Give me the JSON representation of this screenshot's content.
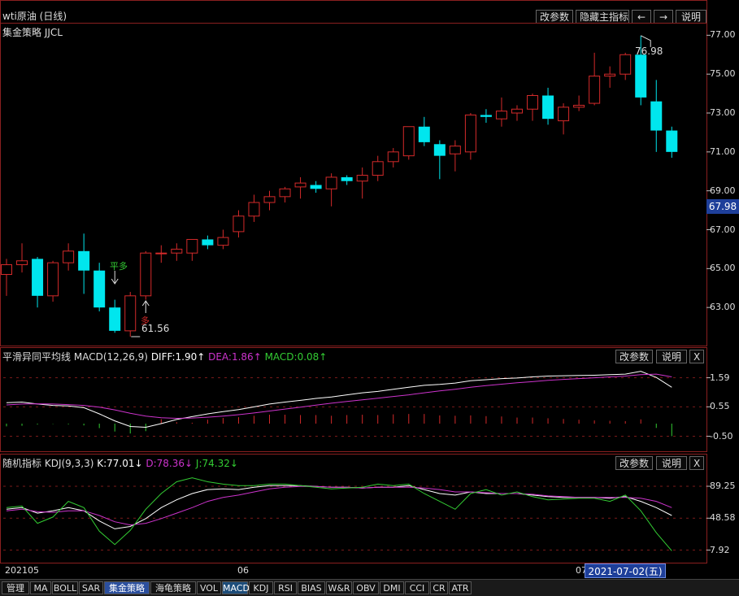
{
  "header": {
    "title": "wti原油 (日线)",
    "strategy": "集金策略 JJCL",
    "buttons": [
      "改参数",
      "隐藏主指标",
      "←",
      "→",
      "说明"
    ]
  },
  "price_axis": [
    "77.00",
    "75.00",
    "73.00",
    "71.00",
    "69.00",
    "67.00",
    "65.00",
    "63.00"
  ],
  "current_price": "67.98",
  "annotations": {
    "high_label": "76.98",
    "low_label": "61.56",
    "signal_close_long": "平多",
    "signal_long": "多"
  },
  "macd_panel": {
    "name": "平滑异同平均线",
    "params": "MACD(12,26,9)",
    "diff": "DIFF:1.90↑",
    "dea": "DEA:1.86↑",
    "macd": "MACD:0.08↑",
    "axis": [
      "1.59",
      "0.55",
      "-0.50"
    ],
    "buttons": [
      "改参数",
      "说明",
      "X"
    ]
  },
  "kdj_panel": {
    "name": "随机指标",
    "params": "KDJ(9,3,3)",
    "k": "K:77.01↓",
    "d": "D:78.36↓",
    "j": "J:74.32↓",
    "axis": [
      "89.25",
      "48.58",
      "7.92"
    ],
    "buttons": [
      "改参数",
      "说明",
      "X"
    ]
  },
  "x_axis": {
    "labels": [
      "202105",
      "06",
      "07"
    ],
    "selected_date": "2021-07-02(五)"
  },
  "tabs": [
    "管理",
    "MA",
    "BOLL",
    "SAR",
    "集金策略",
    "海龟策略",
    "VOL",
    "MACD",
    "KDJ",
    "RSI",
    "BIAS",
    "W&R",
    "OBV",
    "DMI",
    "CCI",
    "CR",
    "ATR"
  ],
  "colors": {
    "up": "#d42a2a",
    "down": "#00e6ee",
    "diff": "#ffffff",
    "dea": "#cc33cc",
    "j_line": "#33cc33",
    "grid": "#8a1f1f"
  },
  "chart_data": [
    {
      "type": "candlestick",
      "title": "wti原油 (日线)",
      "ylim": [
        61.0,
        77.6
      ],
      "candles": [
        {
          "o": 64.7,
          "h": 65.5,
          "l": 63.6,
          "c": 65.2
        },
        {
          "o": 65.2,
          "h": 66.3,
          "l": 64.8,
          "c": 65.4
        },
        {
          "o": 65.5,
          "h": 65.6,
          "l": 63.0,
          "c": 63.6
        },
        {
          "o": 63.6,
          "h": 65.4,
          "l": 63.3,
          "c": 65.3
        },
        {
          "o": 65.3,
          "h": 66.3,
          "l": 64.9,
          "c": 65.9
        },
        {
          "o": 65.9,
          "h": 66.8,
          "l": 63.7,
          "c": 64.9
        },
        {
          "o": 64.9,
          "h": 65.3,
          "l": 62.8,
          "c": 63.0
        },
        {
          "o": 63.0,
          "h": 63.4,
          "l": 61.7,
          "c": 61.8
        },
        {
          "o": 61.8,
          "h": 63.8,
          "l": 61.5,
          "c": 63.6
        },
        {
          "o": 63.6,
          "h": 65.9,
          "l": 63.4,
          "c": 65.8
        },
        {
          "o": 65.8,
          "h": 66.2,
          "l": 65.3,
          "c": 65.8
        },
        {
          "o": 65.8,
          "h": 66.3,
          "l": 65.4,
          "c": 66.0
        },
        {
          "o": 65.8,
          "h": 66.5,
          "l": 65.4,
          "c": 66.5
        },
        {
          "o": 66.5,
          "h": 66.7,
          "l": 66.0,
          "c": 66.2
        },
        {
          "o": 66.2,
          "h": 67.0,
          "l": 66.0,
          "c": 66.6
        },
        {
          "o": 66.9,
          "h": 68.0,
          "l": 66.6,
          "c": 67.7
        },
        {
          "o": 67.7,
          "h": 68.8,
          "l": 67.4,
          "c": 68.4
        },
        {
          "o": 68.4,
          "h": 69.0,
          "l": 68.0,
          "c": 68.7
        },
        {
          "o": 68.7,
          "h": 69.2,
          "l": 68.4,
          "c": 69.1
        },
        {
          "o": 69.2,
          "h": 69.7,
          "l": 68.6,
          "c": 69.4
        },
        {
          "o": 69.3,
          "h": 69.5,
          "l": 68.9,
          "c": 69.1
        },
        {
          "o": 69.1,
          "h": 69.9,
          "l": 68.2,
          "c": 69.7
        },
        {
          "o": 69.7,
          "h": 69.8,
          "l": 69.3,
          "c": 69.5
        },
        {
          "o": 69.5,
          "h": 70.2,
          "l": 68.6,
          "c": 69.8
        },
        {
          "o": 69.8,
          "h": 70.8,
          "l": 69.5,
          "c": 70.5
        },
        {
          "o": 70.5,
          "h": 71.2,
          "l": 70.2,
          "c": 71.0
        },
        {
          "o": 70.8,
          "h": 72.3,
          "l": 70.6,
          "c": 72.3
        },
        {
          "o": 72.3,
          "h": 72.8,
          "l": 71.3,
          "c": 71.5
        },
        {
          "o": 71.4,
          "h": 71.6,
          "l": 69.6,
          "c": 70.8
        },
        {
          "o": 70.9,
          "h": 71.6,
          "l": 70.0,
          "c": 71.3
        },
        {
          "o": 71.0,
          "h": 73.0,
          "l": 70.6,
          "c": 72.9
        },
        {
          "o": 72.9,
          "h": 73.2,
          "l": 72.5,
          "c": 72.8
        },
        {
          "o": 72.7,
          "h": 73.8,
          "l": 72.3,
          "c": 73.1
        },
        {
          "o": 73.0,
          "h": 73.4,
          "l": 72.6,
          "c": 73.2
        },
        {
          "o": 73.2,
          "h": 74.0,
          "l": 72.6,
          "c": 73.9
        },
        {
          "o": 73.9,
          "h": 74.3,
          "l": 72.4,
          "c": 72.7
        },
        {
          "o": 72.6,
          "h": 73.5,
          "l": 71.9,
          "c": 73.3
        },
        {
          "o": 73.3,
          "h": 73.9,
          "l": 73.1,
          "c": 73.4
        },
        {
          "o": 73.5,
          "h": 76.1,
          "l": 73.4,
          "c": 74.9
        },
        {
          "o": 74.9,
          "h": 75.4,
          "l": 74.3,
          "c": 75.0
        },
        {
          "o": 75.0,
          "h": 76.1,
          "l": 74.7,
          "c": 76.0
        },
        {
          "o": 76.0,
          "h": 76.98,
          "l": 73.4,
          "c": 73.8
        },
        {
          "o": 73.6,
          "h": 74.7,
          "l": 71.0,
          "c": 72.1
        },
        {
          "o": 72.1,
          "h": 72.3,
          "l": 70.7,
          "c": 71.0
        }
      ]
    },
    {
      "type": "line",
      "title": "平滑异同平均线 MACD(12,26,9)",
      "ylim": [
        -0.95,
        2.1
      ],
      "series": [
        {
          "name": "DIFF",
          "values": [
            0.7,
            0.72,
            0.65,
            0.6,
            0.58,
            0.52,
            0.3,
            0.05,
            -0.15,
            -0.18,
            -0.05,
            0.1,
            0.2,
            0.3,
            0.38,
            0.45,
            0.55,
            0.65,
            0.72,
            0.78,
            0.85,
            0.9,
            0.98,
            1.05,
            1.1,
            1.18,
            1.25,
            1.32,
            1.35,
            1.4,
            1.48,
            1.52,
            1.56,
            1.58,
            1.62,
            1.65,
            1.66,
            1.67,
            1.68,
            1.7,
            1.72,
            1.82,
            1.6,
            1.25
          ]
        },
        {
          "name": "DEA",
          "values": [
            0.62,
            0.65,
            0.66,
            0.65,
            0.63,
            0.6,
            0.54,
            0.44,
            0.32,
            0.22,
            0.16,
            0.14,
            0.15,
            0.18,
            0.22,
            0.27,
            0.33,
            0.4,
            0.47,
            0.54,
            0.61,
            0.68,
            0.74,
            0.8,
            0.86,
            0.92,
            0.98,
            1.05,
            1.12,
            1.18,
            1.25,
            1.31,
            1.36,
            1.41,
            1.45,
            1.5,
            1.53,
            1.56,
            1.59,
            1.62,
            1.65,
            1.7,
            1.72,
            1.62
          ]
        },
        {
          "name": "MACD",
          "values": [
            0.15,
            0.12,
            0.05,
            0.02,
            0.04,
            0.1,
            0.25,
            0.44,
            0.55,
            0.42,
            0.25,
            0.08,
            0.05,
            0.22,
            0.32,
            0.36,
            0.44,
            0.5,
            0.5,
            0.48,
            0.48,
            0.44,
            0.48,
            0.5,
            0.48,
            0.52,
            0.54,
            0.54,
            0.46,
            0.44,
            0.46,
            0.42,
            0.4,
            0.34,
            0.34,
            0.3,
            0.26,
            0.22,
            0.18,
            0.16,
            0.14,
            0.24,
            0.24,
            0.7
          ]
        }
      ]
    },
    {
      "type": "line",
      "title": "随机指标 KDJ(9,3,3)",
      "ylim": [
        -5,
        110
      ],
      "series": [
        {
          "name": "K",
          "values": [
            60,
            62,
            55,
            58,
            62,
            58,
            45,
            35,
            38,
            48,
            62,
            72,
            80,
            85,
            86,
            85,
            88,
            90,
            90,
            90,
            89,
            88,
            88,
            87,
            88,
            88,
            90,
            85,
            80,
            78,
            82,
            80,
            80,
            80,
            78,
            76,
            75,
            75,
            75,
            74,
            76,
            70,
            62,
            52
          ]
        },
        {
          "name": "D",
          "values": [
            58,
            60,
            57,
            56,
            58,
            58,
            52,
            44,
            40,
            42,
            48,
            55,
            62,
            70,
            75,
            78,
            82,
            86,
            88,
            89,
            89,
            88,
            88,
            87,
            88,
            88,
            88,
            87,
            85,
            82,
            82,
            81,
            80,
            80,
            79,
            77,
            76,
            75,
            75,
            75,
            75,
            74,
            70,
            62
          ]
        },
        {
          "name": "J",
          "values": [
            62,
            64,
            42,
            50,
            70,
            62,
            32,
            15,
            33,
            60,
            80,
            95,
            100,
            95,
            92,
            90,
            90,
            92,
            92,
            90,
            88,
            86,
            87,
            88,
            92,
            90,
            92,
            80,
            70,
            60,
            80,
            85,
            78,
            82,
            76,
            72,
            73,
            74,
            74,
            70,
            78,
            58,
            30,
            7
          ]
        }
      ]
    }
  ]
}
